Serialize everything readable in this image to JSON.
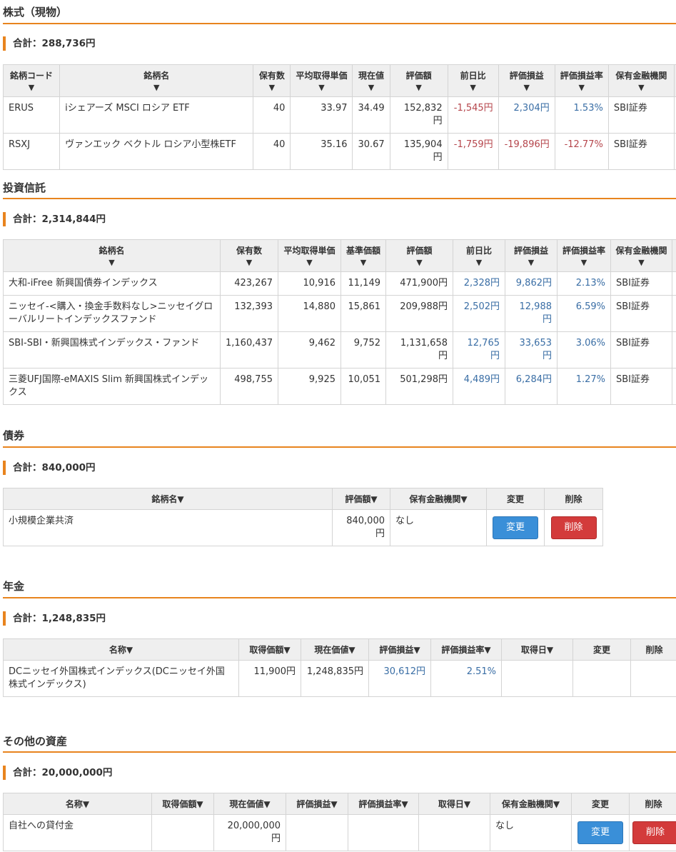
{
  "stocks": {
    "title": "株式（現物）",
    "total": "合計：288,736円",
    "headers": [
      "銘柄コード",
      "銘柄名",
      "保有数",
      "平均取得単価",
      "現在値",
      "評価額",
      "前日比",
      "評価損益",
      "評価損益率",
      "保有金融機関"
    ],
    "rows": [
      [
        "ERUS",
        "iシェアーズ MSCI ロシア ETF",
        "40",
        "33.97",
        "34.49",
        "152,832円",
        "-1,545円",
        "2,304円",
        "1.53%",
        "SBI証券"
      ],
      [
        "RSXJ",
        "ヴァンエック ベクトル ロシア小型株ETF",
        "40",
        "35.16",
        "30.67",
        "135,904円",
        "-1,759円",
        "-19,896円",
        "-12.77%",
        "SBI証券"
      ]
    ]
  },
  "funds": {
    "title": "投資信託",
    "total": "合計：2,314,844円",
    "headers": [
      "銘柄名",
      "保有数",
      "平均取得単価",
      "基準価額",
      "評価額",
      "前日比",
      "評価損益",
      "評価損益率",
      "保有金融機関"
    ],
    "rows": [
      [
        "大和-iFree 新興国債券インデックス",
        "423,267",
        "10,916",
        "11,149",
        "471,900円",
        "2,328円",
        "9,862円",
        "2.13%",
        "SBI証券"
      ],
      [
        "ニッセイ-<購入・換金手数料なし>ニッセイグローバルリートインデックスファンド",
        "132,393",
        "14,880",
        "15,861",
        "209,988円",
        "2,502円",
        "12,988円",
        "6.59%",
        "SBI証券"
      ],
      [
        "SBI-SBI・新興国株式インデックス・ファンド",
        "1,160,437",
        "9,462",
        "9,752",
        "1,131,658円",
        "12,765円",
        "33,653円",
        "3.06%",
        "SBI証券"
      ],
      [
        "三菱UFJ国際-eMAXIS Slim 新興国株式インデックス",
        "498,755",
        "9,925",
        "10,051",
        "501,298円",
        "4,489円",
        "6,284円",
        "1.27%",
        "SBI証券"
      ]
    ]
  },
  "bonds": {
    "title": "債券",
    "total": "合計：840,000円",
    "headers": [
      "銘柄名▼",
      "評価額▼",
      "保有金融機関▼",
      "変更",
      "削除"
    ],
    "rows": [
      {
        "name": "小規模企業共済",
        "value": "840,000円",
        "institution": "なし",
        "edit": "変更",
        "delete": "削除"
      }
    ]
  },
  "pension": {
    "title": "年金",
    "total": "合計：1,248,835円",
    "headers": [
      "名称▼",
      "取得価額▼",
      "現在価値▼",
      "評価損益▼",
      "評価損益率▼",
      "取得日▼",
      "変更",
      "削除"
    ],
    "rows": [
      {
        "name": "DCニッセイ外国株式インデックス(DCニッセイ外国株式インデックス)",
        "cost": "11,900円",
        "current": "1,248,835円",
        "gain": "30,612円",
        "rate": "2.51%",
        "date": ""
      }
    ]
  },
  "other": {
    "title": "その他の資産",
    "total": "合計：20,000,000円",
    "headers": [
      "名称▼",
      "取得価額▼",
      "現在価値▼",
      "評価損益▼",
      "評価損益率▼",
      "取得日▼",
      "保有金融機関▼",
      "変更",
      "削除"
    ],
    "rows": [
      {
        "name": "自社への貸付金",
        "cost": "",
        "current": "20,000,000円",
        "gain": "",
        "rate": "",
        "date": "",
        "institution": "なし",
        "edit": "変更",
        "delete": "削除"
      }
    ]
  },
  "arrow": "▼",
  "colors": {
    "accent": "#e8841e",
    "negative": "#b5454b",
    "positive": "#3a6ea5",
    "edit_button": "#3a8fd8",
    "delete_button": "#d33b3b"
  }
}
